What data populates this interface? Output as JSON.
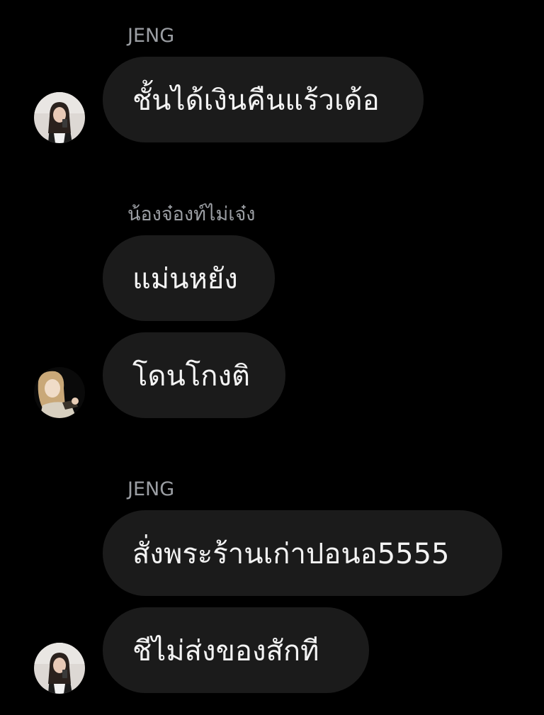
{
  "messages": {
    "group1": {
      "sender": "JENG",
      "bubbles": [
        "ชั้นได้เงินคืนแร้วเด้อ"
      ]
    },
    "group2": {
      "sender": "น้องจ๋องท์ไม่เจ๋ง",
      "bubbles": [
        "แม่นหยัง",
        "โดนโกงติ"
      ]
    },
    "group3": {
      "sender": "JENG",
      "bubbles": [
        "สั่งพระร้านเก่าปอนอ5555",
        "ชีไม่ส่งของสักที"
      ]
    }
  },
  "avatars": {
    "jeng": "avatar-jeng",
    "nong_jong": "avatar-nong-jong"
  },
  "colors": {
    "background": "#000000",
    "bubble": "#1b1b1b",
    "sender_text": "#9b9ea3",
    "message_text": "#f3f3f3"
  }
}
